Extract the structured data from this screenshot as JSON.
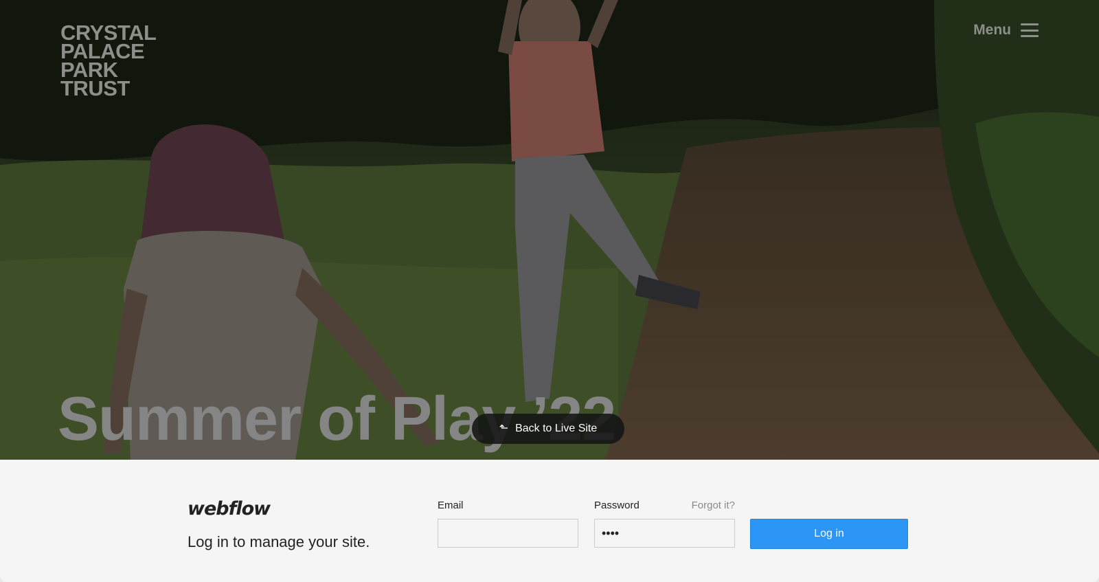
{
  "hero": {
    "logo_lines": [
      "CRYSTAL",
      "PALACE",
      "PARK",
      "TRUST"
    ],
    "menu_label": "Menu",
    "headline": "Summer of Play ’22",
    "back_to_live_label": "Back to Live Site"
  },
  "login": {
    "brand": "webflow",
    "tagline": "Log in to manage your site.",
    "email_label": "Email",
    "email_value": "",
    "password_label": "Password",
    "password_value": "••••",
    "forgot_label": "Forgot it?",
    "submit_label": "Log in"
  },
  "icons": {
    "menu": "hamburger-icon",
    "back": "arrow-up-left-icon"
  },
  "colors": {
    "accent": "#2b96f5",
    "overlay_text": "#8d8f8a",
    "login_bg": "#f5f5f5"
  }
}
